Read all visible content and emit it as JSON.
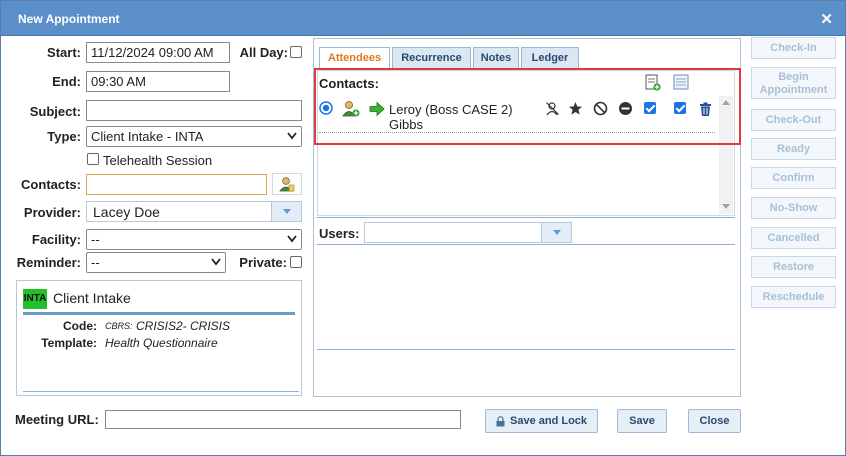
{
  "window": {
    "title": "New Appointment"
  },
  "form": {
    "start_label": "Start:",
    "start_value": "11/12/2024 09:00 AM",
    "all_day_label": "All Day:",
    "end_label": "End:",
    "end_value": "09:30 AM",
    "subject_label": "Subject:",
    "subject_value": "",
    "type_label": "Type:",
    "type_value": "Client Intake - INTA",
    "telehealth_label": "Telehealth Session",
    "contacts_label": "Contacts:",
    "contacts_value": "",
    "provider_label": "Provider:",
    "provider_value": "Lacey Doe",
    "facility_label": "Facility:",
    "facility_value": "--",
    "reminder_label": "Reminder:",
    "reminder_value": "--",
    "private_label": "Private:"
  },
  "type_info": {
    "badge": "INTA",
    "badge_color": "#22c02a",
    "name": "Client Intake",
    "code_label": "Code:",
    "code_prefix": "CBRS:",
    "code_value": "CRISIS2- CRISIS",
    "template_label": "Template:",
    "template_value": "Health Questionnaire"
  },
  "tabs": [
    {
      "label": "Attendees",
      "active": true
    },
    {
      "label": "Recurrence"
    },
    {
      "label": "Notes"
    },
    {
      "label": "Ledger"
    }
  ],
  "attendees": {
    "contacts_header": "Contacts:",
    "contact_name_line1": "Leroy (Boss CASE 2)",
    "contact_name_line2": "Gibbs",
    "users_label": "Users:",
    "users_value": "",
    "highlight_color": "#e03a3e"
  },
  "side_buttons": [
    "Check-In",
    "Begin Appointment",
    "Check-Out",
    "Ready",
    "Confirm",
    "No-Show",
    "Cancelled",
    "Restore",
    "Reschedule"
  ],
  "bottom": {
    "meeting_url_label": "Meeting URL:",
    "meeting_url_value": "",
    "save_and_lock": "Save and Lock",
    "save": "Save",
    "close": "Close"
  }
}
